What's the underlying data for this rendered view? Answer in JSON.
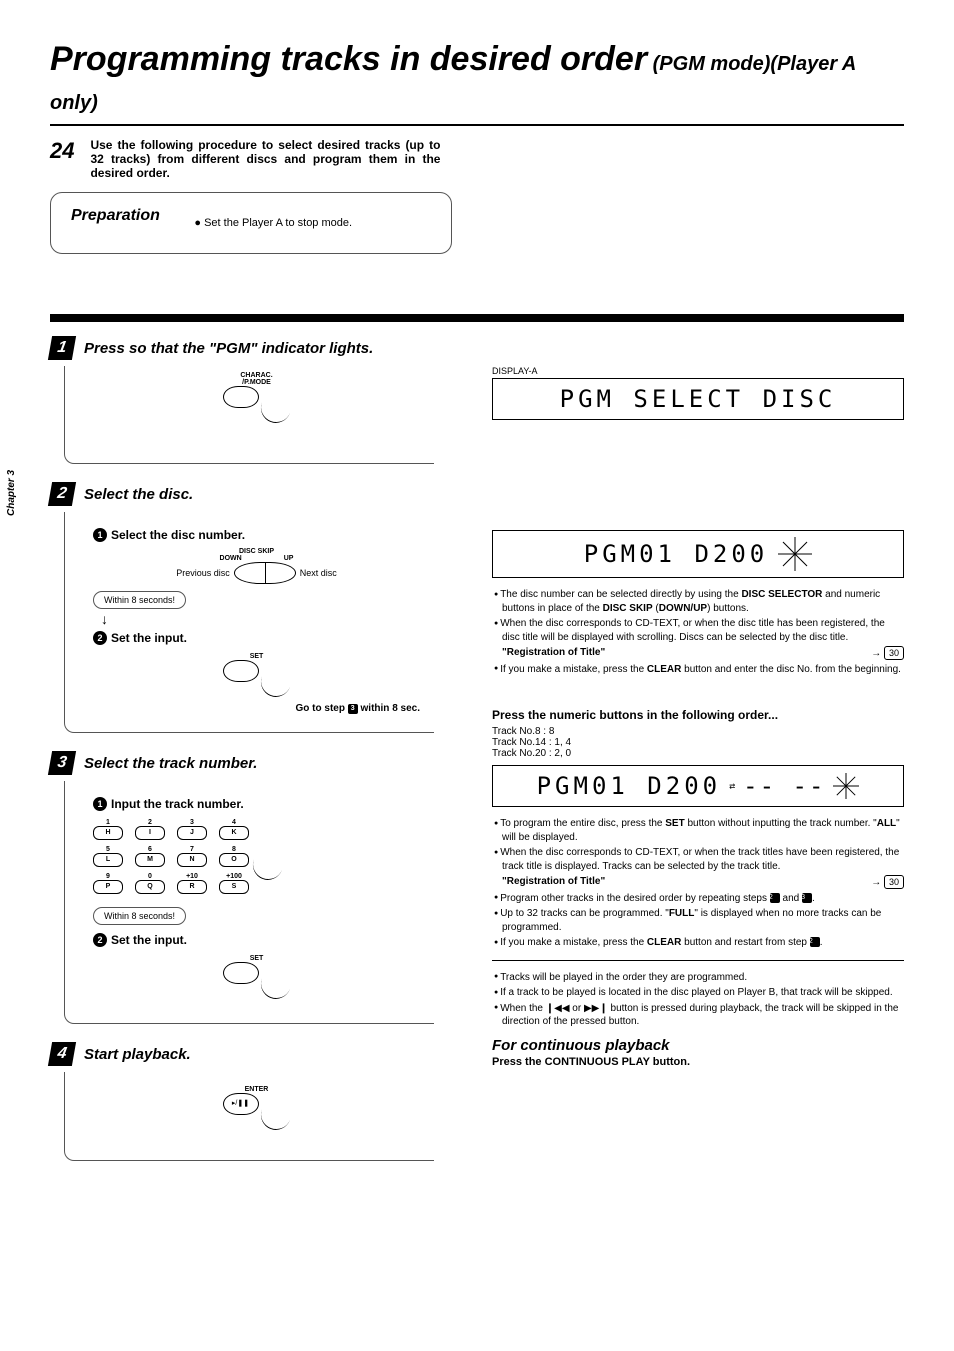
{
  "title_main": "Programming tracks in desired order",
  "title_sub": " (PGM mode)(Player A only)",
  "page_number": "24",
  "chapter_side": "Chapter 3",
  "intro_text": "Use the following procedure to select desired tracks (up to 32 tracks) from different discs and program them in the desired order.",
  "prep": {
    "title": "Preparation",
    "item": "Set the Player A to stop mode."
  },
  "steps": {
    "s1": {
      "num": "1",
      "title": "Press so that the \"PGM\" indicator lights.",
      "button_label": "CHARAC.\n/P.MODE"
    },
    "s2": {
      "num": "2",
      "title": "Select the disc.",
      "sub1_num": "1",
      "sub1_title": "Select the disc number.",
      "disc_skip": "DISC SKIP",
      "disc_down": "DOWN",
      "disc_up": "UP",
      "prev": "Previous disc",
      "next": "Next disc",
      "within": "Within 8 seconds!",
      "sub2_num": "2",
      "sub2_title": "Set the input.",
      "set_label": "SET",
      "goto": "Go to step 3 within 8 sec."
    },
    "s3": {
      "num": "3",
      "title": "Select the track number.",
      "sub1_num": "1",
      "sub1_title": "Input the track number.",
      "keys": {
        "r1": [
          {
            "t": "1",
            "b": "H"
          },
          {
            "t": "2",
            "b": "I"
          },
          {
            "t": "3",
            "b": "J"
          },
          {
            "t": "4",
            "b": "K"
          }
        ],
        "r2": [
          {
            "t": "5",
            "b": "L"
          },
          {
            "t": "6",
            "b": "M"
          },
          {
            "t": "7",
            "b": "N"
          },
          {
            "t": "8",
            "b": "O"
          }
        ],
        "r3": [
          {
            "t": "9",
            "b": "P"
          },
          {
            "t": "0",
            "b": "Q"
          },
          {
            "t": "+10",
            "b": "R"
          },
          {
            "t": "+100",
            "b": "S"
          }
        ]
      },
      "within": "Within 8 seconds!",
      "sub2_num": "2",
      "sub2_title": "Set the input.",
      "set_label": "SET"
    },
    "s4": {
      "num": "4",
      "title": "Start playback.",
      "enter_label": "ENTER",
      "play_sym": "▸/❚❚"
    }
  },
  "right": {
    "display_a": "DISPLAY-A",
    "lcd1": "PGM SELECT DISC",
    "lcd2": "PGM01 D200",
    "lcd3": "PGM01 D200",
    "notes1": {
      "n1a": "The disc number can be selected directly by using the ",
      "n1b": "DISC SELECTOR",
      "n1c": " and numeric buttons in place of the ",
      "n1d": "DISC SKIP",
      "n1e": " (",
      "n1f": "DOWN/UP",
      "n1g": ") buttons.",
      "n2": "When the disc corresponds to CD-TEXT, or when the disc title has been registered, the disc title will be displayed with scrolling. Discs can be selected by the disc title.",
      "reg": "\"Registration of Title\"",
      "ref": "30",
      "n3a": "If you make a mistake, press the ",
      "n3b": "CLEAR",
      "n3c": " button and enter the disc No. from the beginning."
    },
    "press_numeric": "Press the numeric buttons in the following order...",
    "track8": "Track No.8  : 8",
    "track14": "Track No.14 : 1, 4",
    "track20": "Track No.20 : 2, 0",
    "notes2": {
      "n1a": "To program the entire disc, press the ",
      "n1b": "SET",
      "n1c": " button without inputting the track number. \"",
      "n1d": "ALL",
      "n1e": "\" will be displayed.",
      "n2": "When the disc corresponds to CD-TEXT, or when the track titles have been registered, the track title is displayed. Tracks can be selected by the track title.",
      "reg": "\"Registration of Title\"",
      "ref": "30",
      "n3": "Program other tracks in the desired order by repeating steps ",
      "n3and": " and ",
      "n4a": "Up to 32 tracks can be programmed. \"",
      "n4b": "FULL",
      "n4c": "\" is displayed when no more tracks can be programmed.",
      "n5a": "If you make a mistake, press the ",
      "n5b": "CLEAR",
      "n5c": " button and restart from step "
    },
    "notes3": {
      "n1": "Tracks will be played in the order they are programmed.",
      "n2": "If a track to be played is located in the disc played on Player B, that track will be skipped.",
      "n3": "When the ❙◀◀ or ▶▶❙ button is pressed during playback, the track will be skipped in the direction of the pressed button."
    },
    "continuous_title": "For continuous playback",
    "continuous_text": "Press the CONTINUOUS PLAY button."
  }
}
